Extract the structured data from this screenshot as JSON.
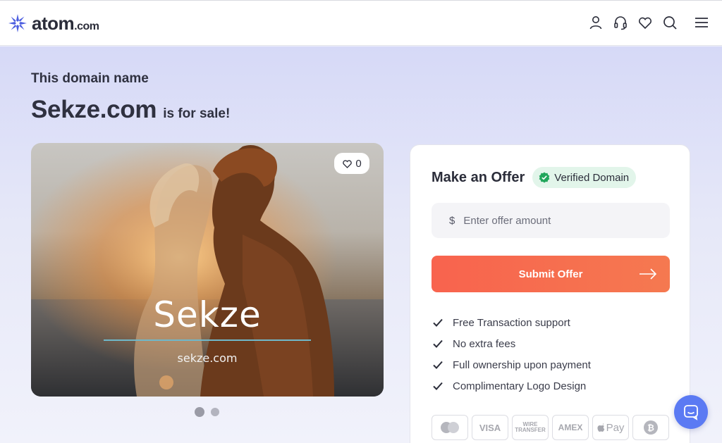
{
  "header": {
    "logo_text": "atom",
    "logo_tld": ".com",
    "icons": [
      "user-icon",
      "headset-icon",
      "heart-icon",
      "search-icon",
      "menu-icon"
    ]
  },
  "hero": {
    "eyebrow": "This domain name",
    "domain": "Sekze.com",
    "suffix": "is for sale!"
  },
  "image_card": {
    "brand_name": "Sekze",
    "brand_domain": "sekze.com",
    "like_count": "0",
    "slides_total": 2,
    "slide_active": 1
  },
  "offer": {
    "title": "Make an Offer",
    "verified_label": "Verified Domain",
    "currency": "$",
    "amount_placeholder": "Enter offer amount",
    "submit_label": "Submit Offer",
    "features": [
      "Free Transaction support",
      "No extra fees",
      "Full ownership upon payment",
      "Complimentary Logo Design"
    ],
    "payment_methods": [
      "mastercard-icon",
      "VISA",
      "WIRE TRANSFER",
      "AMEX",
      "Pay",
      "bitcoin-icon"
    ]
  },
  "colors": {
    "accent": "#f8634e",
    "brand": "#4d5fe0",
    "verified_green": "#21a65b",
    "chat": "#5b7af3"
  }
}
